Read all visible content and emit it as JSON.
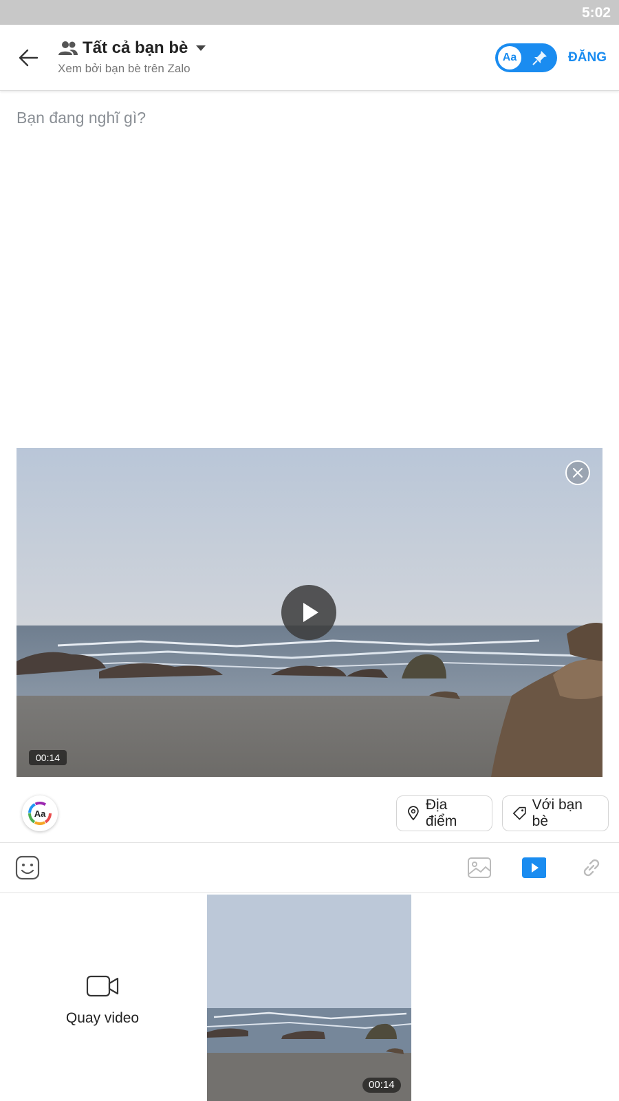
{
  "status_bar": {
    "time": "5:02"
  },
  "header": {
    "audience_title": "Tất cả bạn bè",
    "audience_subtitle": "Xem bởi bạn bè trên Zalo",
    "mode_toggle_label": "Aa",
    "post_label": "ĐĂNG"
  },
  "compose": {
    "placeholder": "Bạn đang nghĩ gì?"
  },
  "video": {
    "duration": "00:14"
  },
  "actions": {
    "font_style_label": "Aa",
    "location_label": "Địa điểm",
    "tag_friends_label": "Với bạn bè"
  },
  "picker": {
    "record_label": "Quay video",
    "items": [
      {
        "duration": "00:14"
      }
    ]
  },
  "colors": {
    "accent": "#1a8cf0",
    "placeholder": "#8a8f95"
  }
}
